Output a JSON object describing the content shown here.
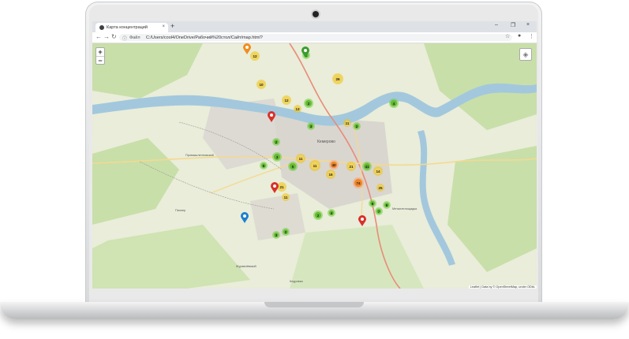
{
  "browser": {
    "tab_title": "Карта концентраций",
    "tab_close": "×",
    "new_tab": "+",
    "window_controls": [
      "–",
      "❐",
      "×"
    ],
    "nav": {
      "back": "←",
      "forward": "→",
      "reload": "↻"
    },
    "address": {
      "info_icon": "ⓘ",
      "label": "Файл",
      "url": "C:/Users/cool4/OneDrive/Рабочий%20стол/Сайт/map.html?"
    },
    "star": "☆",
    "profile": "●",
    "menu": "⋮"
  },
  "map": {
    "zoom_in": "+",
    "zoom_out": "−",
    "layers_icon": "◈",
    "attribution": "Leaflet | Data by © OpenStreetMap, under ODbL",
    "labels": [
      "Кемерово",
      "Промышленновский",
      "Журавлёвский",
      "Металлплощадка",
      "Пионер",
      "Кедровка"
    ],
    "clusters": [
      {
        "count": "12",
        "color": "yellow"
      },
      {
        "count": "10",
        "color": "yellow"
      },
      {
        "count": "2",
        "color": "green"
      },
      {
        "count": "26",
        "color": "yellow"
      },
      {
        "count": "12",
        "color": "yellow"
      },
      {
        "count": "2",
        "color": "green"
      },
      {
        "count": "13",
        "color": "yellow"
      },
      {
        "count": "3",
        "color": "green"
      },
      {
        "count": "11",
        "color": "yellow"
      },
      {
        "count": "2",
        "color": "green"
      },
      {
        "count": "4",
        "color": "green"
      },
      {
        "count": "2",
        "color": "green"
      },
      {
        "count": "3",
        "color": "green"
      },
      {
        "count": "5",
        "color": "green"
      },
      {
        "count": "11",
        "color": "yellow"
      },
      {
        "count": "11",
        "color": "yellow"
      },
      {
        "count": "40",
        "color": "orange"
      },
      {
        "count": "16",
        "color": "yellow"
      },
      {
        "count": "21",
        "color": "yellow"
      },
      {
        "count": "41",
        "color": "green"
      },
      {
        "count": "14",
        "color": "yellow"
      },
      {
        "count": "74",
        "color": "orange"
      },
      {
        "count": "25",
        "color": "yellow"
      },
      {
        "count": "5",
        "color": "green"
      },
      {
        "count": "21",
        "color": "yellow"
      },
      {
        "count": "11",
        "color": "yellow"
      },
      {
        "count": "6",
        "color": "green"
      },
      {
        "count": "2",
        "color": "green"
      },
      {
        "count": "3",
        "color": "green"
      },
      {
        "count": "2",
        "color": "green"
      },
      {
        "count": "4",
        "color": "green"
      },
      {
        "count": "7",
        "color": "green"
      },
      {
        "count": "9",
        "color": "green"
      }
    ],
    "pins": [
      {
        "color": "#f28c1b"
      },
      {
        "color": "#3a9c2f"
      },
      {
        "color": "#d9302a"
      },
      {
        "color": "#d9302a"
      },
      {
        "color": "#1c7fd0"
      },
      {
        "color": "#d9302a"
      }
    ]
  },
  "colors": {
    "water": "#a3c8dd",
    "forest": "#c8dfa9",
    "urban": "#d9d6cf",
    "road_major": "#e98b7a",
    "road_secondary": "#f5d98f"
  }
}
